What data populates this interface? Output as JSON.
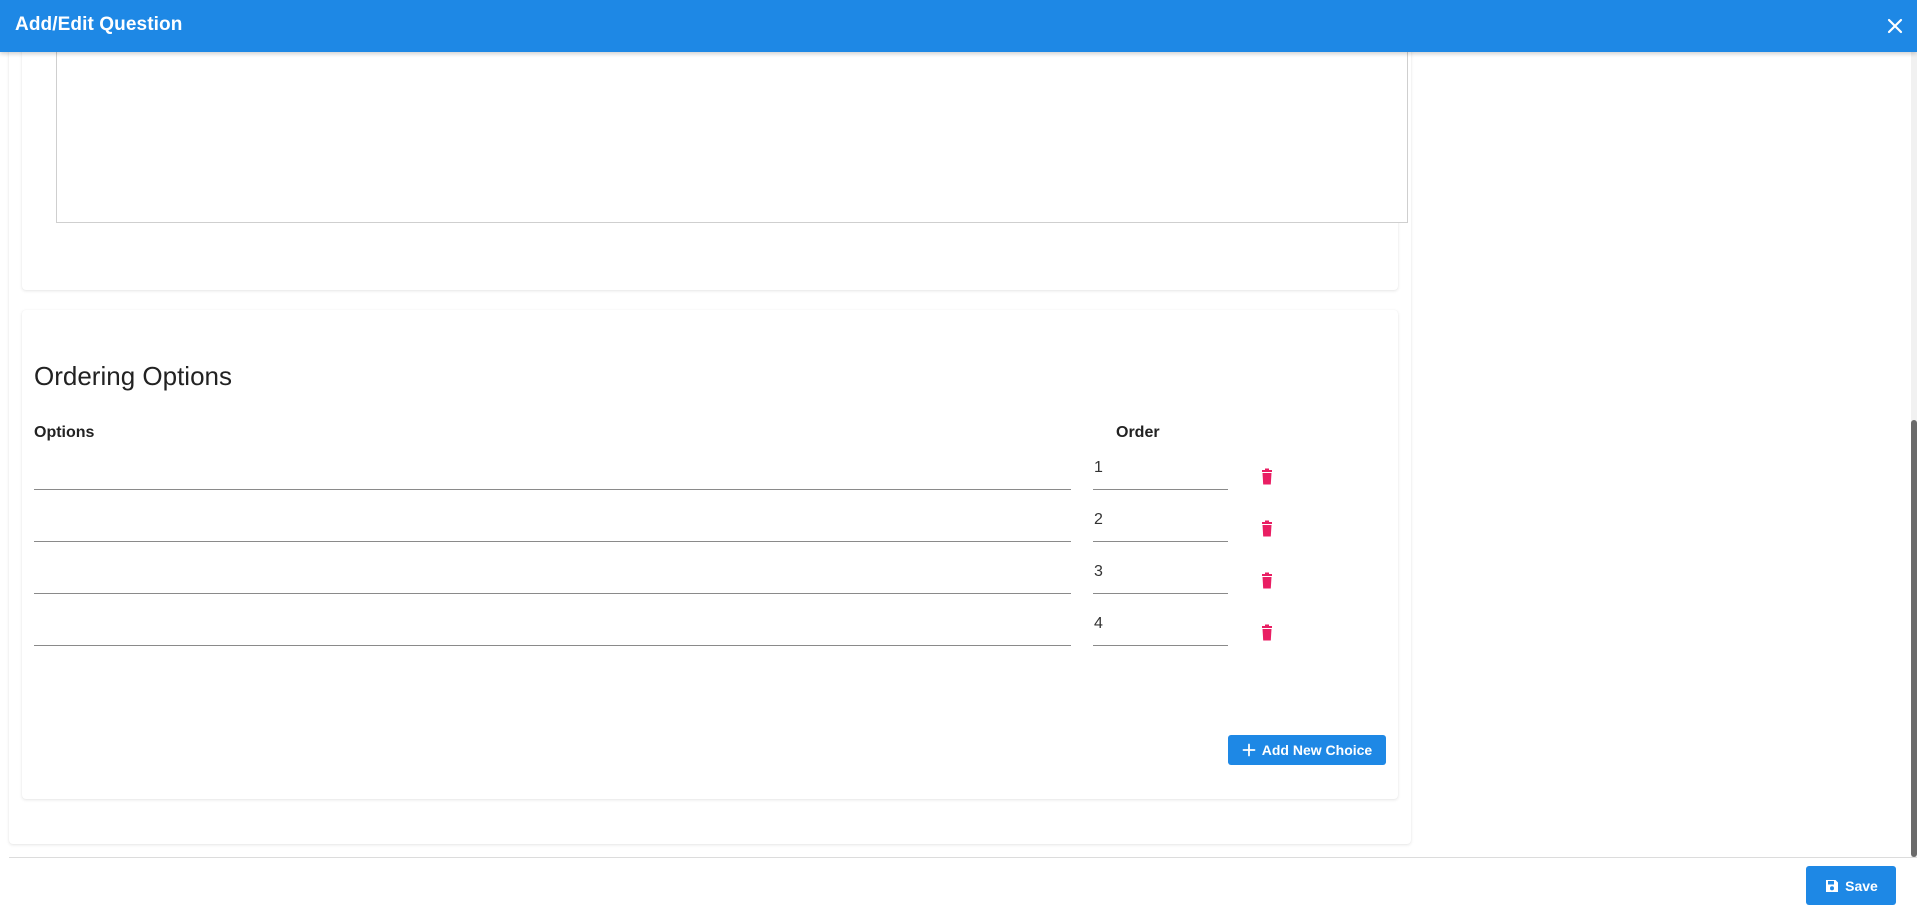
{
  "header": {
    "title": "Add/Edit Question",
    "close_icon": "close-icon"
  },
  "ordering": {
    "title": "Ordering Options",
    "col_options": "Options",
    "col_order": "Order",
    "rows": [
      {
        "option": "",
        "order": "1"
      },
      {
        "option": "",
        "order": "2"
      },
      {
        "option": "",
        "order": "3"
      },
      {
        "option": "",
        "order": "4"
      }
    ],
    "add_choice_label": "Add New Choice"
  },
  "footer": {
    "save_label": "Save"
  },
  "colors": {
    "accent": "#1e88e5",
    "delete": "#e91e63"
  }
}
